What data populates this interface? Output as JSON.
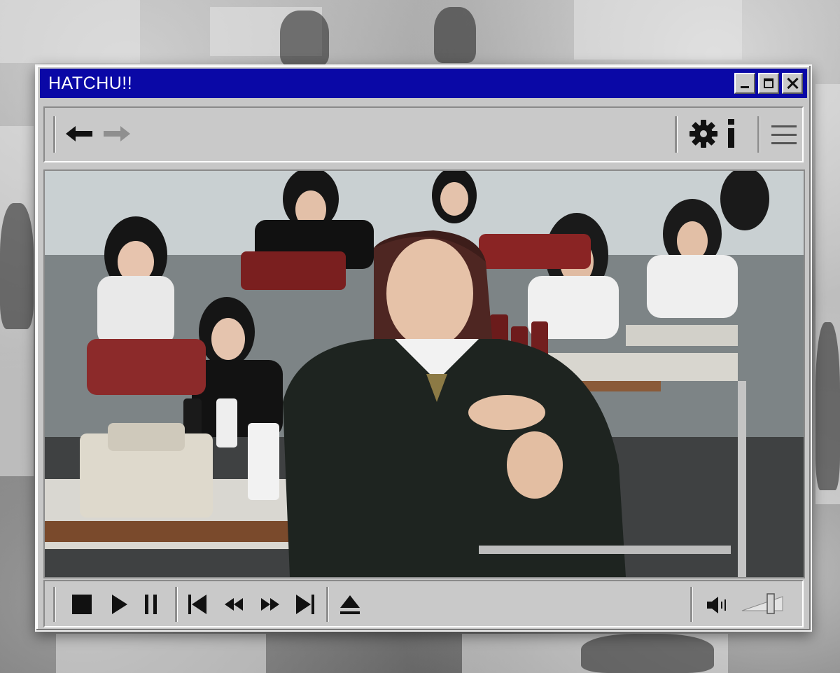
{
  "window": {
    "title": "HATCHU!!",
    "title_bar_color": "#0a08a6"
  },
  "title_buttons": [
    "minimize-icon",
    "maximize-icon",
    "close-icon"
  ],
  "toolbar": {
    "nav": [
      "arrow-left-icon",
      "arrow-right-icon"
    ],
    "right": [
      "gear-icon",
      "info-icon",
      "hamburger-menu-icon"
    ]
  },
  "video": {
    "description_icon": "video-frame"
  },
  "controls": {
    "buttons": [
      "stop-icon",
      "play-icon",
      "pause-icon",
      "skip-previous-icon",
      "rewind-icon",
      "fast-forward-icon",
      "skip-next-icon",
      "eject-icon"
    ],
    "volume_icon": "speaker-icon",
    "volume_level": 0.75
  }
}
